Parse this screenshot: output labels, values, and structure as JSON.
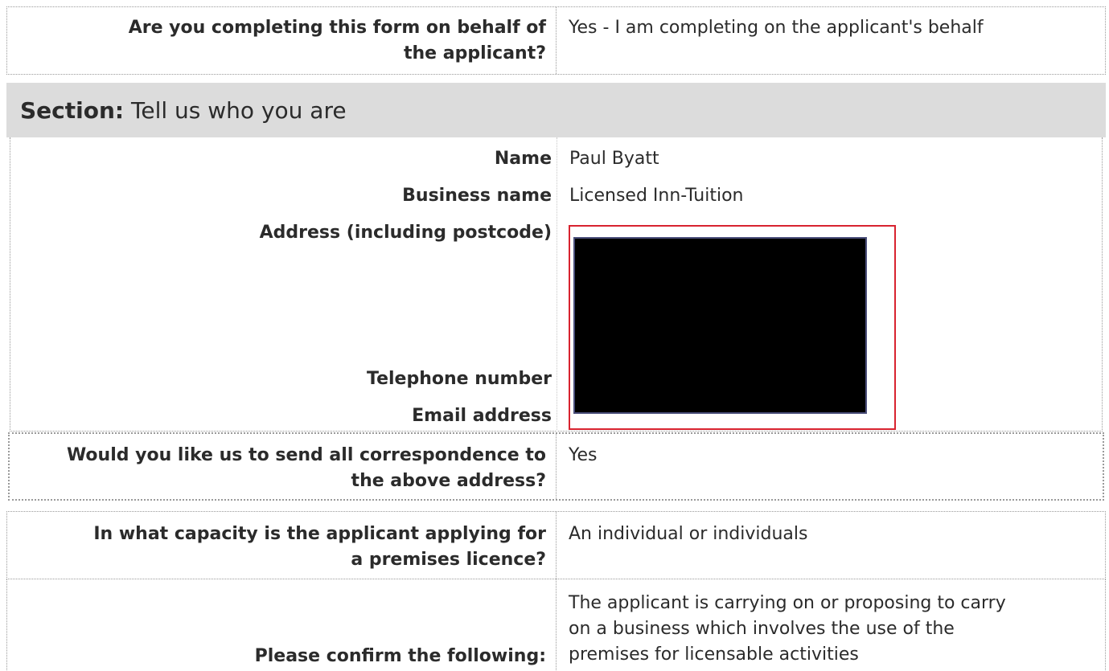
{
  "behalf": {
    "question": "Are you completing this form on behalf of the applicant?",
    "answer": "Yes - I am completing on the applicant's behalf"
  },
  "section": {
    "prefix": "Section:",
    "title": "Tell us who you are"
  },
  "who": {
    "name_label": "Name",
    "name_value": "Paul Byatt",
    "business_label": "Business name",
    "business_value": "Licensed Inn-Tuition",
    "address_label": "Address (including postcode)",
    "telephone_label": "Telephone number",
    "email_label": "Email address"
  },
  "correspondence": {
    "question": "Would you like us to send all correspondence to the above address?",
    "answer": "Yes"
  },
  "capacity": {
    "question": "In what capacity is the applicant applying for a premises licence?",
    "answer": "An individual or individuals"
  },
  "confirm": {
    "question": "Please confirm the following:",
    "answer": "The applicant is carrying on or proposing to carry on a business which involves the use of the premises for licensable activities"
  }
}
